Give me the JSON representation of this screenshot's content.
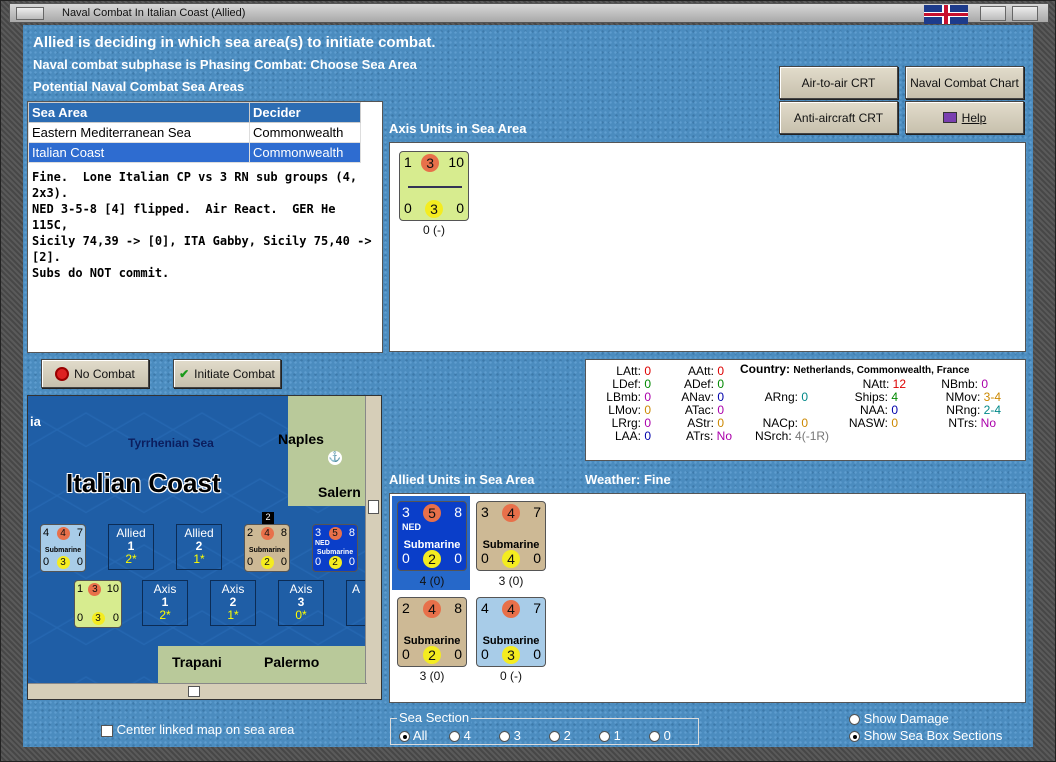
{
  "window": {
    "title": "Naval Combat In Italian Coast (Allied)"
  },
  "header": {
    "line1": "Allied is deciding in which sea area(s) to initiate combat.",
    "line2": "Naval combat subphase is Phasing Combat: Choose Sea Area",
    "line3": "Potential Naval Combat Sea Areas"
  },
  "buttons": {
    "air_to_air": "Air-to-air CRT",
    "naval_chart": "Naval Combat Chart",
    "anti_aircraft": "Anti-aircraft CRT",
    "help": "Help",
    "no_combat": "No Combat",
    "initiate": "Initiate Combat"
  },
  "sea_table": {
    "headers": [
      "Sea Area",
      "Decider"
    ],
    "rows": [
      {
        "area": "Eastern Mediterranean Sea",
        "decider": "Commonwealth"
      },
      {
        "area": "Italian Coast",
        "decider": "Commonwealth"
      }
    ],
    "note": "Fine.  Lone Italian CP vs 3 RN sub groups (4, 2x3).\nNED 3-5-8 [4] flipped.  Air React.  GER He 115C,\nSicily 74,39 -> [0], ITA Gabby, Sicily 75,40 ->[2].\nSubs do NOT commit."
  },
  "axis": {
    "label": "Axis Units in Sea Area",
    "unit": {
      "tl": "1",
      "tm": "3",
      "tr": "10",
      "bl": "0",
      "bm": "3",
      "br": "0",
      "caption": "0 (-)"
    }
  },
  "stats": {
    "latt": "LAtt:",
    "latt_v": "0",
    "ldef": "LDef:",
    "ldef_v": "0",
    "lbmb": "LBmb:",
    "lbmb_v": "0",
    "lmov": "LMov:",
    "lmov_v": "0",
    "lrrg": "LRrg:",
    "lrrg_v": "0",
    "laa": "LAA:",
    "laa_v": "0",
    "aatt": "AAtt:",
    "aatt_v": "0",
    "adef": "ADef:",
    "adef_v": "0",
    "anav": "ANav:",
    "anav_v": "0",
    "atac": "ATac:",
    "atac_v": "0",
    "astr": "AStr:",
    "astr_v": "0",
    "atrs": "ATrs:",
    "atrs_v": "No",
    "arng": "ARng:",
    "arng_v": "0",
    "nacp": "NACp:",
    "nacp_v": "0",
    "nsrch": "NSrch:",
    "nsrch_v": "4(-1R)",
    "country": "Country:",
    "country_v": "Netherlands, Commonwealth, France",
    "natt": "NAtt:",
    "natt_v": "12",
    "ships": "Ships:",
    "ships_v": "4",
    "naa": "NAA:",
    "naa_v": "0",
    "nasw": "NASW:",
    "nasw_v": "0",
    "nbmb": "NBmb:",
    "nbmb_v": "0",
    "nmov": "NMov:",
    "nmov_v": "3-4",
    "nrng": "NRng:",
    "nrng_v": "2-4",
    "ntrs": "NTrs:",
    "ntrs_v": "No"
  },
  "allied": {
    "label": "Allied Units in Sea Area",
    "weather": "Weather:  Fine",
    "units": [
      {
        "tl": "3",
        "tm": "5",
        "tr": "8",
        "name": "Submarine",
        "tag": "NED",
        "bl": "0",
        "bm": "2",
        "br": "0",
        "caption": "4 (0)"
      },
      {
        "tl": "3",
        "tm": "4",
        "tr": "7",
        "name": "Submarine",
        "tag": "",
        "bl": "0",
        "bm": "4",
        "br": "0",
        "caption": "3 (0)"
      },
      {
        "tl": "2",
        "tm": "4",
        "tr": "8",
        "name": "Submarine",
        "tag": "",
        "bl": "0",
        "bm": "2",
        "br": "0",
        "caption": "3 (0)"
      },
      {
        "tl": "4",
        "tm": "4",
        "tr": "7",
        "name": "Submarine",
        "tag": "",
        "bl": "0",
        "bm": "3",
        "br": "0",
        "caption": "0 (-)"
      }
    ]
  },
  "map": {
    "sea_name": "Tyrrhenian Sea",
    "area_name": "Italian Coast",
    "cities": [
      "Naples",
      "Salern",
      "Trapani",
      "Palermo"
    ],
    "edge_label": "ia",
    "allied_boxes": [
      {
        "side": "Allied",
        "num": "1",
        "star": "2*"
      },
      {
        "side": "Allied",
        "num": "2",
        "star": "1*"
      }
    ],
    "axis_boxes": [
      {
        "side": "Axis",
        "num": "1",
        "star": "2*"
      },
      {
        "side": "Axis",
        "num": "2",
        "star": "1*"
      },
      {
        "side": "Axis",
        "num": "3",
        "star": "0*"
      },
      {
        "side": "A",
        "num": "",
        "star": ""
      }
    ],
    "counters": [
      {
        "tl": "4",
        "tm": "4",
        "tr": "7",
        "bl": "0",
        "bm": "3",
        "br": "0",
        "name": "Submarine"
      },
      {
        "tl": "2",
        "tm": "4",
        "tr": "8",
        "bl": "0",
        "bm": "2",
        "br": "0",
        "name": "Submarine",
        "stack": "2"
      },
      {
        "tl": "3",
        "tm": "5",
        "tr": "8",
        "bl": "0",
        "bm": "2",
        "br": "0",
        "name": "Submarine",
        "tag": "NED"
      },
      {
        "tl": "1",
        "tm": "3",
        "tr": "10",
        "bl": "0",
        "bm": "3",
        "br": "0",
        "name": ""
      }
    ]
  },
  "center_map": "Center linked map on sea area",
  "sea_section": {
    "title": "Sea Section",
    "options": [
      "All",
      "4",
      "3",
      "2",
      "1",
      "0"
    ]
  },
  "show": {
    "damage": "Show Damage",
    "boxes": "Show Sea Box Sections"
  }
}
